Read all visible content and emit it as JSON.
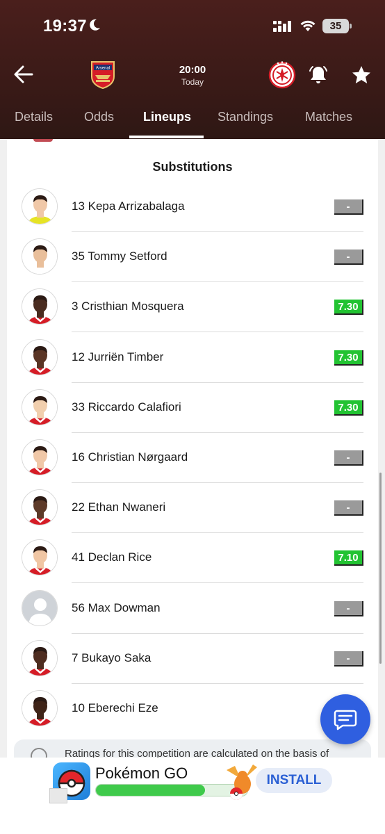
{
  "status_bar": {
    "time": "19:37",
    "battery": "35"
  },
  "match": {
    "time": "20:00",
    "date": "Today",
    "home_team": "Arsenal"
  },
  "tabs": [
    {
      "label": "Details",
      "active": false
    },
    {
      "label": "Odds",
      "active": false
    },
    {
      "label": "Lineups",
      "active": true
    },
    {
      "label": "Standings",
      "active": false
    },
    {
      "label": "Matches",
      "active": false
    }
  ],
  "lineups": {
    "section_title": "Substitutions",
    "players": [
      {
        "name": "13 Kepa Arrizabalaga",
        "rating": "-",
        "kit": "yellow"
      },
      {
        "name": "35 Tommy Setford",
        "rating": "-",
        "kit": "none"
      },
      {
        "name": "3 Cristhian Mosquera",
        "rating": "7.30",
        "kit": "red"
      },
      {
        "name": "12 Jurriën Timber",
        "rating": "7.30",
        "kit": "red"
      },
      {
        "name": "33 Riccardo Calafiori",
        "rating": "7.30",
        "kit": "red"
      },
      {
        "name": "16 Christian Nørgaard",
        "rating": "-",
        "kit": "red"
      },
      {
        "name": "22 Ethan Nwaneri",
        "rating": "-",
        "kit": "red"
      },
      {
        "name": "41 Declan Rice",
        "rating": "7.10",
        "kit": "red"
      },
      {
        "name": "56 Max Dowman",
        "rating": "-",
        "kit": "placeholder"
      },
      {
        "name": "7 Bukayo Saka",
        "rating": "-",
        "kit": "red"
      },
      {
        "name": "10 Eberechi Eze",
        "rating": "",
        "kit": "red"
      }
    ],
    "info_text": "Ratings for this competition are calculated on the basis of"
  },
  "ad": {
    "title": "Pokémon GO",
    "install_label": "INSTALL",
    "progress": 0.72
  },
  "colors": {
    "header_bg": "#3a1a17",
    "rating_good": "#22c332",
    "rating_none": "#9a9a9a",
    "fab": "#2f5fe0",
    "install_text": "#2a5fd4"
  }
}
